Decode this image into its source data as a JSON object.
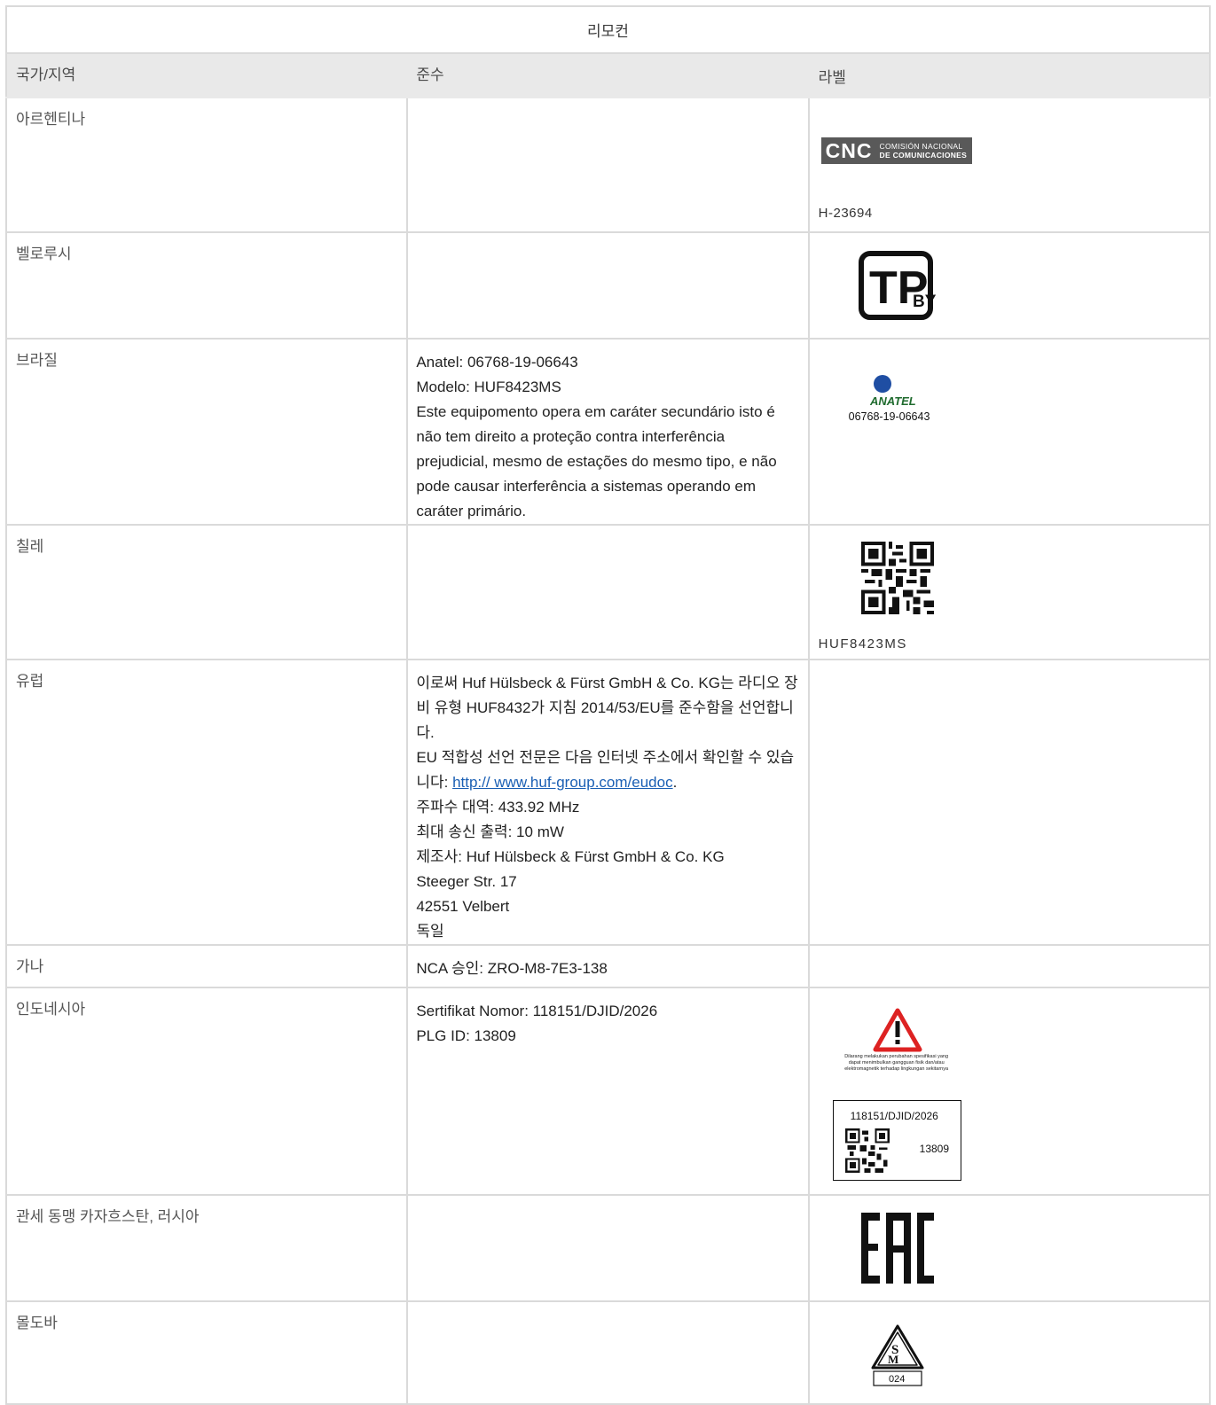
{
  "title": "리모컨",
  "headers": {
    "country": "국가/지역",
    "compliance": "준수",
    "label": "라벨"
  },
  "rows": {
    "argentina": {
      "country": "아르헨티나",
      "label_text": "H-23694",
      "logo_main": "CNC",
      "logo_line1": "COMISIÓN NACIONAL",
      "logo_line2": "DE COMUNICACIONES"
    },
    "belarus": {
      "country": "벨로루시",
      "logo_main": "TP",
      "logo_sub": "BY"
    },
    "brazil": {
      "country": "브라질",
      "lines": [
        "Anatel: 06768-19-06643",
        "Modelo: HUF8423MS",
        "Este equipomento opera em caráter secundário isto é não tem direito a proteção contra interferência prejudicial, mesmo de estações do mesmo tipo, e não pode causar interferência a sistemas operando em caráter primário."
      ],
      "logo_name": "ANATEL",
      "logo_number": "06768-19-06643"
    },
    "chile": {
      "country": "칠레",
      "label_text": "HUF8423MS"
    },
    "europe": {
      "country": "유럽",
      "line1": "이로써 Huf Hülsbeck & Fürst GmbH & Co. KG는 라디오 장비 유형 HUF8432가 지침 2014/53/EU를 준수함을 선언합니다.",
      "line2_prefix": "EU 적합성 선언 전문은 다음 인터넷 주소에서 확인할 수 있습니다: ",
      "link": "http:// www.huf-group.com/eudoc",
      "line2_suffix": ".",
      "lines_rest": [
        "주파수 대역: 433.92 MHz",
        "최대 송신 출력: 10 mW",
        "제조사: Huf Hülsbeck & Fürst GmbH & Co. KG",
        "Steeger Str. 17",
        "42551 Velbert",
        "독일"
      ]
    },
    "ghana": {
      "country": "가나",
      "line": "NCA 승인: ZRO-M8-7E3-138"
    },
    "indonesia": {
      "country": "인도네시아",
      "lines": [
        "Sertifikat Nomor: 118151/DJID/2026",
        "PLG ID: 13809"
      ],
      "warning_lines": [
        "Dilarang melakukan perubahan spesifikasi yang",
        "dapat menimbulkan gangguan fisik dan/atau",
        "elektromagnetik terhadap lingkungan sekitarnya"
      ],
      "cert_number": "118151/DJID/2026",
      "plg": "13809"
    },
    "eaeu": {
      "country": "관세 동맹 카자흐스탄, 러시아",
      "logo": "EAC"
    },
    "moldova": {
      "country": "몰도바",
      "logo_number": "024"
    }
  }
}
